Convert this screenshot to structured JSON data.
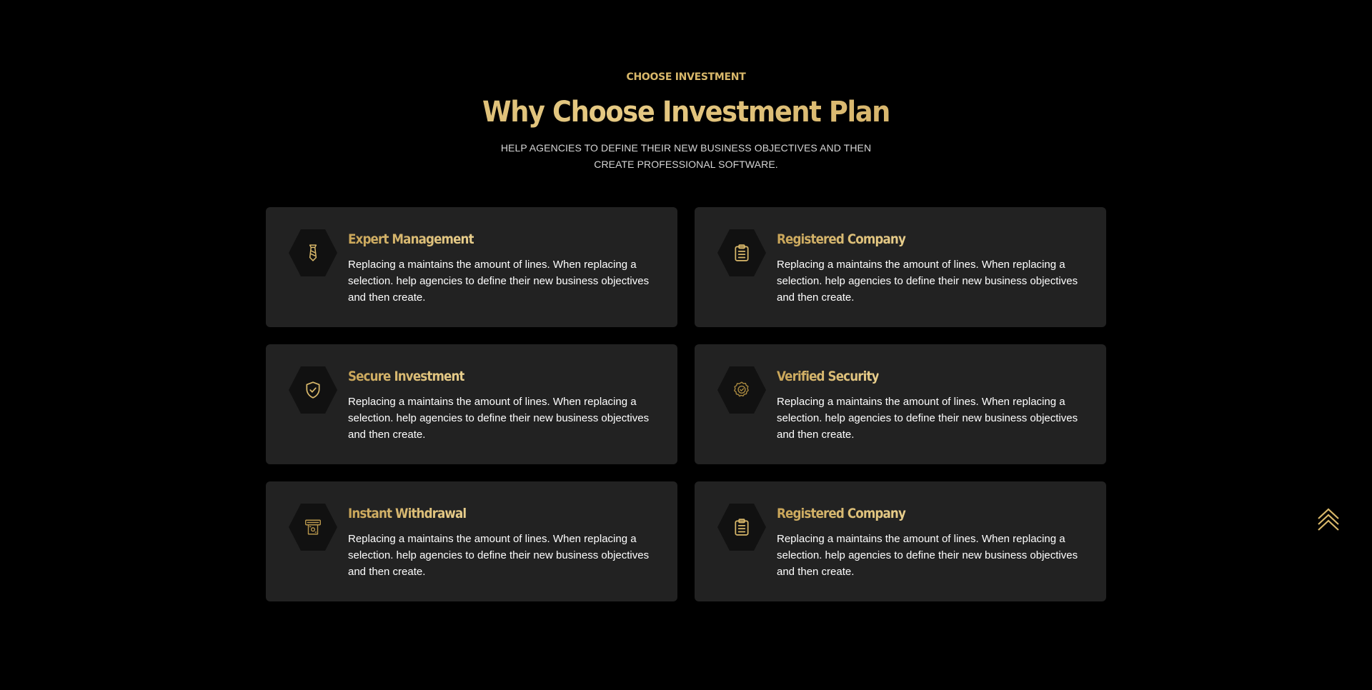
{
  "header": {
    "eyebrow": "CHOOSE INVESTMENT",
    "title": "Why Choose Investment Plan",
    "subtitle": "HELP AGENCIES TO DEFINE THEIR NEW BUSINESS OBJECTIVES AND THEN CREATE PROFESSIONAL SOFTWARE."
  },
  "colors": {
    "background": "#000000",
    "card": "#222222",
    "hexagon": "#111111",
    "gold": "#d9b86a",
    "text": "#ffffff"
  },
  "features": [
    {
      "icon": "tie-icon",
      "title": "Expert Management",
      "text": "Replacing a maintains the amount of lines. When replacing a selection. help agencies to define their new business objectives and then create."
    },
    {
      "icon": "clipboard-icon",
      "title": "Registered Company",
      "text": "Replacing a maintains the amount of lines. When replacing a selection. help agencies to define their new business objectives and then create."
    },
    {
      "icon": "shield-check-icon",
      "title": "Secure Investment",
      "text": "Replacing a maintains the amount of lines. When replacing a selection. help agencies to define their new business objectives and then create."
    },
    {
      "icon": "verified-badge-icon",
      "title": "Verified Security",
      "text": "Replacing a maintains the amount of lines. When replacing a selection. help agencies to define their new business objectives and then create."
    },
    {
      "icon": "atm-withdrawal-icon",
      "title": "Instant Withdrawal",
      "text": "Replacing a maintains the amount of lines. When replacing a selection. help agencies to define their new business objectives and then create."
    },
    {
      "icon": "clipboard-icon",
      "title": "Registered Company",
      "text": "Replacing a maintains the amount of lines. When replacing a selection. help agencies to define their new business objectives and then create."
    }
  ],
  "scroll_top": {
    "icon": "chevrons-up-icon"
  }
}
